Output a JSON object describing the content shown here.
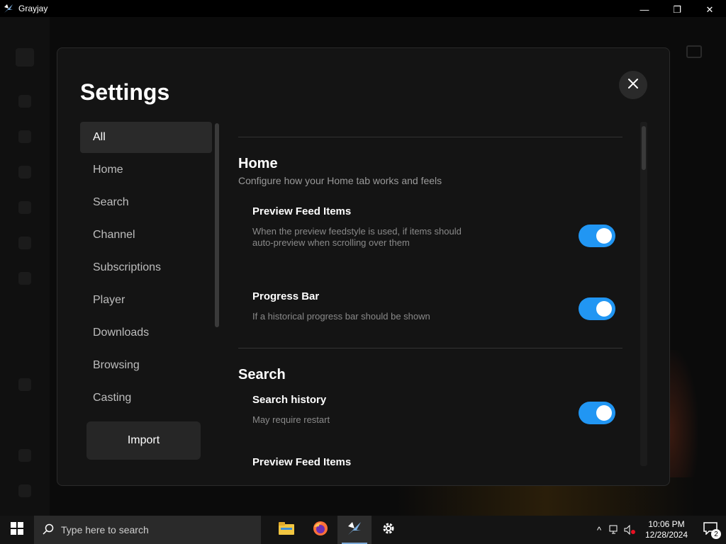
{
  "window": {
    "title": "Grayjay",
    "minimize_glyph": "—",
    "maximize_glyph": "❐",
    "close_glyph": "✕"
  },
  "settings": {
    "title": "Settings",
    "close_icon": "close-icon",
    "nav": {
      "items": [
        {
          "label": "All",
          "active": true
        },
        {
          "label": "Home",
          "active": false
        },
        {
          "label": "Search",
          "active": false
        },
        {
          "label": "Channel",
          "active": false
        },
        {
          "label": "Subscriptions",
          "active": false
        },
        {
          "label": "Player",
          "active": false
        },
        {
          "label": "Downloads",
          "active": false
        },
        {
          "label": "Browsing",
          "active": false
        },
        {
          "label": "Casting",
          "active": false
        }
      ]
    },
    "import_label": "Import",
    "sections": [
      {
        "title": "Home",
        "description": "Configure how your Home tab works and feels",
        "settings": [
          {
            "title": "Preview Feed Items",
            "description": "When the preview feedstyle is used, if items should auto-preview when scrolling over them",
            "enabled": true
          },
          {
            "title": "Progress Bar",
            "description": "If a historical progress bar should be shown",
            "enabled": true
          }
        ]
      },
      {
        "title": "Search",
        "description": "",
        "settings": [
          {
            "title": "Search history",
            "description": "May require restart",
            "enabled": true
          },
          {
            "title": "Preview Feed Items",
            "description": ""
          }
        ]
      }
    ]
  },
  "taskbar": {
    "search_placeholder": "Type here to search",
    "apps": [
      "file-explorer-icon",
      "firefox-icon",
      "grayjay-icon",
      "settings-icon"
    ],
    "time": "10:06 PM",
    "date": "12/28/2024",
    "notification_count": "2",
    "tray_chevron": "^"
  },
  "colors": {
    "accent": "#2196f3",
    "dialog_bg": "#141414",
    "nav_active_bg": "#2a2a2a"
  }
}
